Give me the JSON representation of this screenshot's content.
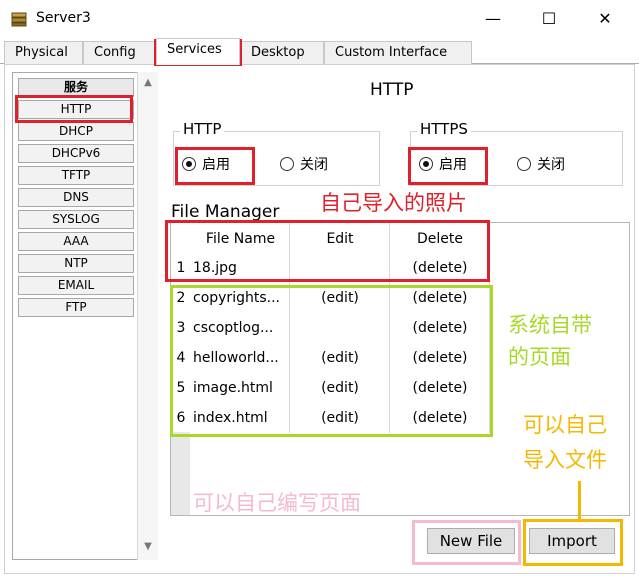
{
  "window": {
    "title": "Server3",
    "minimize_glyph": "—",
    "maximize_glyph": "☐",
    "close_glyph": "✕"
  },
  "tabs": [
    "Physical",
    "Config",
    "Services",
    "Desktop",
    "Custom Interface"
  ],
  "sidebar": {
    "header": "服务",
    "items": [
      "HTTP",
      "DHCP",
      "DHCPv6",
      "TFTP",
      "DNS",
      "SYSLOG",
      "AAA",
      "NTP",
      "EMAIL",
      "FTP"
    ]
  },
  "main": {
    "title": "HTTP",
    "http": {
      "legend": "HTTP",
      "on_label": "启用",
      "off_label": "关闭",
      "selected": "on"
    },
    "https": {
      "legend": "HTTPS",
      "on_label": "启用",
      "off_label": "关闭",
      "selected": "on"
    },
    "file_manager": {
      "title": "File Manager",
      "columns": {
        "name": "File Name",
        "edit": "Edit",
        "delete": "Delete"
      },
      "rows": [
        {
          "index": "1",
          "name": "18.jpg",
          "edit": "",
          "delete": "(delete)"
        },
        {
          "index": "2",
          "name": "copyrights...",
          "edit": "(edit)",
          "delete": "(delete)"
        },
        {
          "index": "3",
          "name": "cscoptlog...",
          "edit": "",
          "delete": "(delete)"
        },
        {
          "index": "4",
          "name": "helloworld...",
          "edit": "(edit)",
          "delete": "(delete)"
        },
        {
          "index": "5",
          "name": "image.html",
          "edit": "(edit)",
          "delete": "(delete)"
        },
        {
          "index": "6",
          "name": "index.html",
          "edit": "(edit)",
          "delete": "(delete)"
        }
      ]
    },
    "buttons": {
      "new_file": "New File",
      "import": "Import"
    }
  },
  "annotations": {
    "imported_photo": "自己导入的照片",
    "system_pages_line1": "系统自带",
    "system_pages_line2": "的页面",
    "import_files_line1": "可以自己",
    "import_files_line2": "导入文件",
    "write_pages": "可以自己编写页面"
  },
  "colors": {
    "red": "#e0202a",
    "green": "#a8d82a",
    "yellow": "#f5b800",
    "pink": "#f6b9cf"
  }
}
